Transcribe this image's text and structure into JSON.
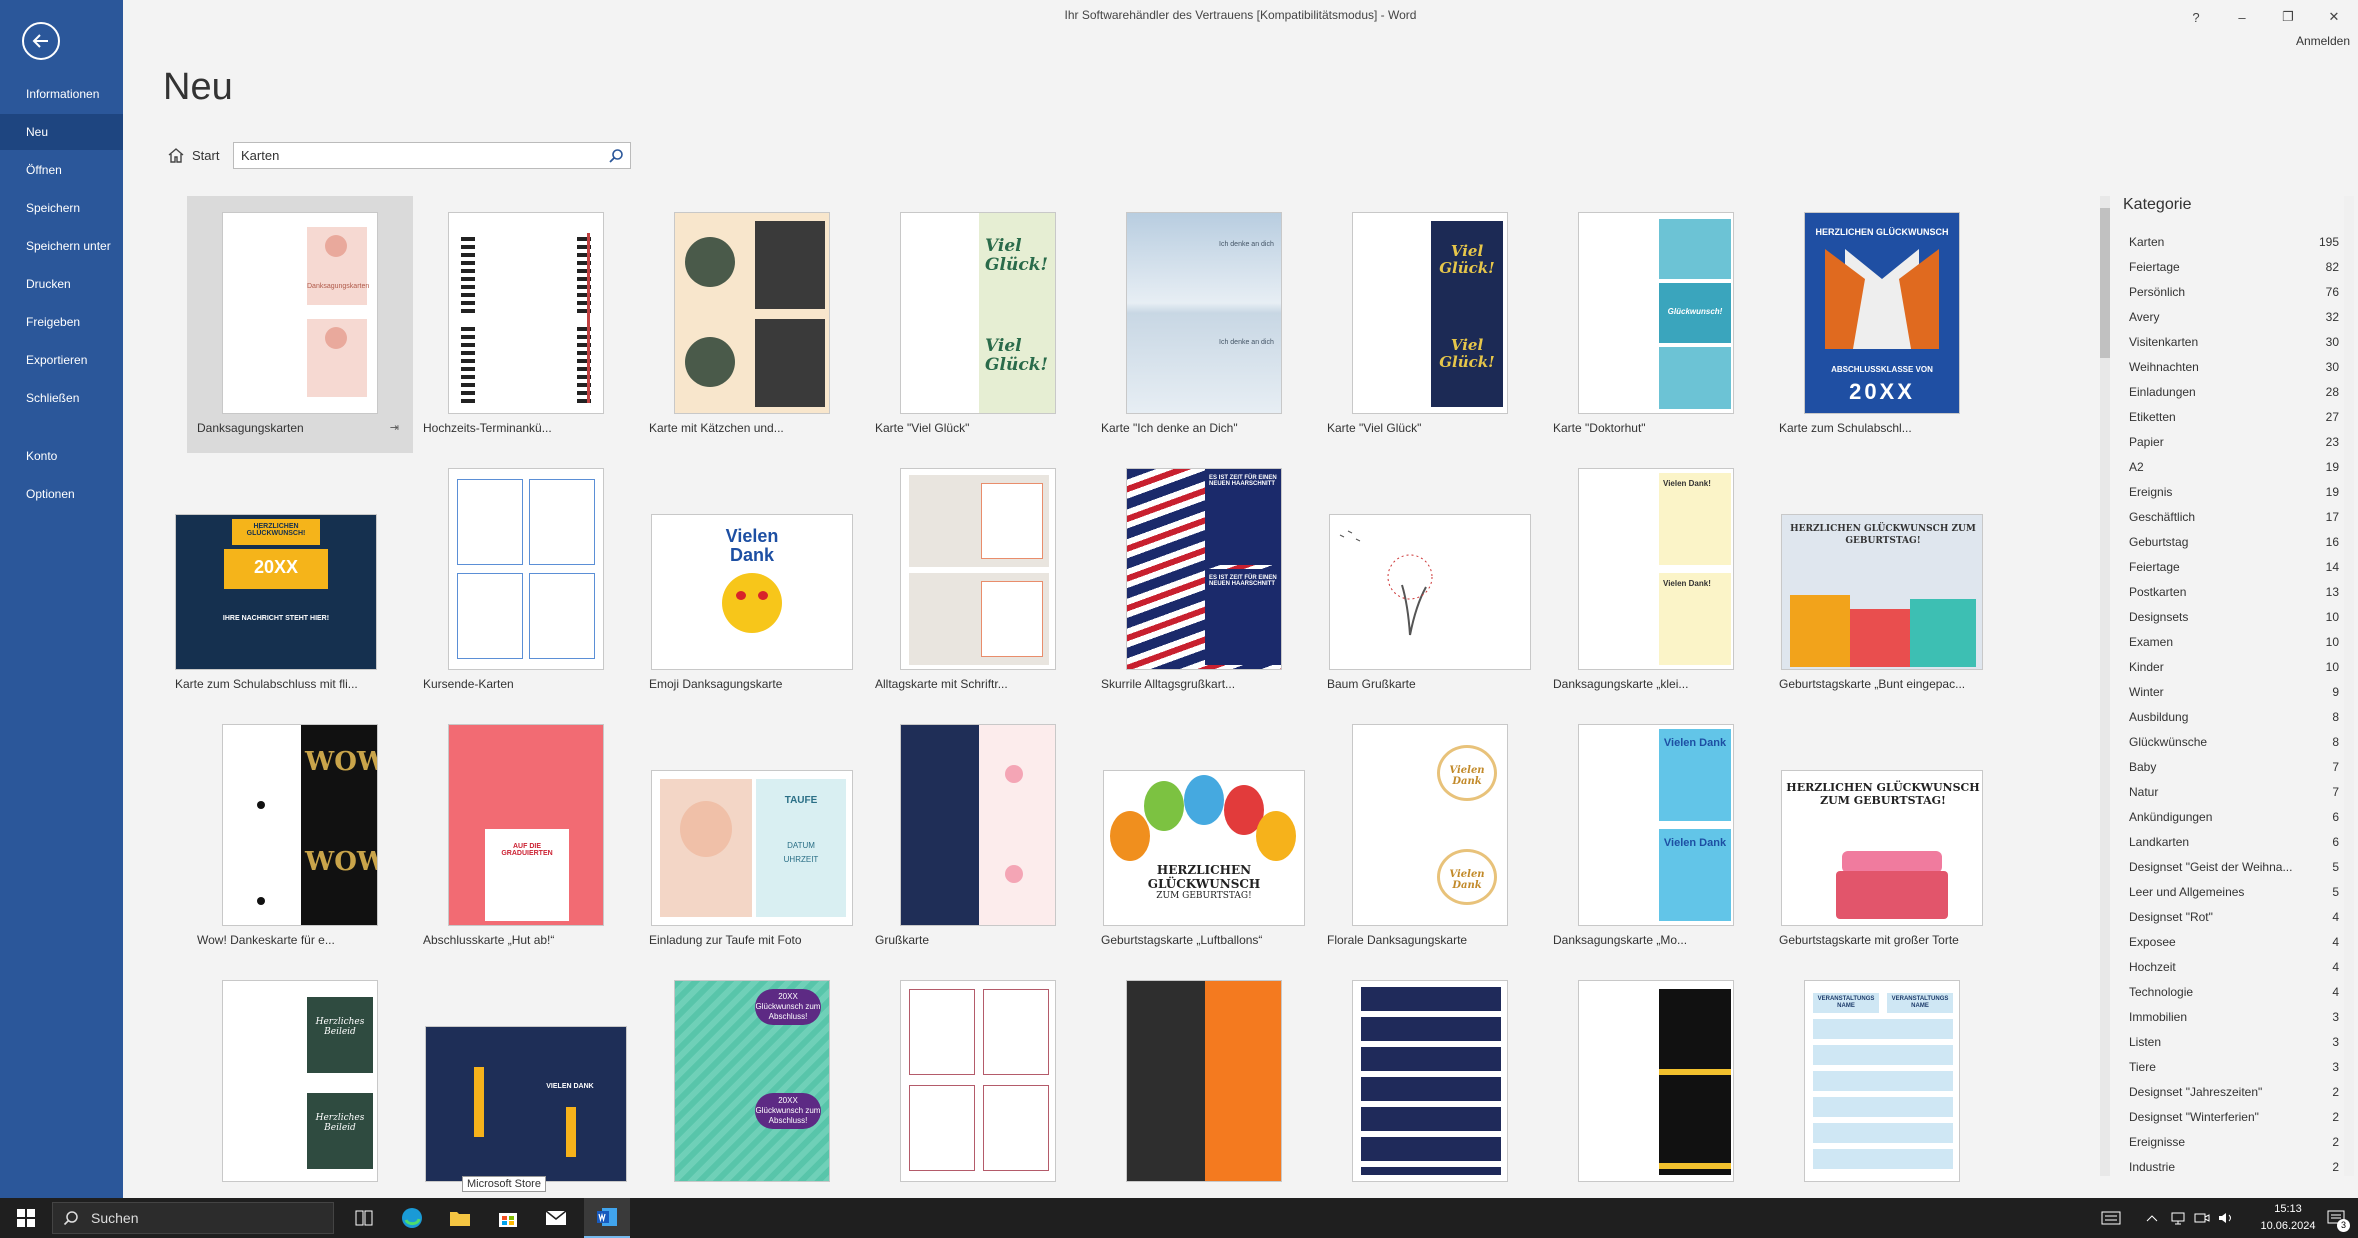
{
  "window": {
    "title": "Ihr Softwarehändler des Vertrauens [Kompatibilitätsmodus] - Word",
    "help": "?",
    "minimize": "–",
    "restore": "❐",
    "close": "✕",
    "signin": "Anmelden"
  },
  "sidebar": {
    "items": [
      {
        "label": "Informationen"
      },
      {
        "label": "Neu"
      },
      {
        "label": "Öffnen"
      },
      {
        "label": "Speichern"
      },
      {
        "label": "Speichern unter"
      },
      {
        "label": "Drucken"
      },
      {
        "label": "Freigeben"
      },
      {
        "label": "Exportieren"
      },
      {
        "label": "Schließen"
      },
      {
        "label": "Konto"
      },
      {
        "label": "Optionen"
      }
    ]
  },
  "main": {
    "title": "Neu",
    "start_label": "Start",
    "search_value": "Karten"
  },
  "templates": [
    {
      "name": "Danksagungskarten",
      "pin": "⇥"
    },
    {
      "name": "Hochzeits-Terminankü..."
    },
    {
      "name": "Karte mit Kätzchen und..."
    },
    {
      "name": "Karte \"Viel Glück\"",
      "text": "Viel Glück!"
    },
    {
      "name": "Karte \"Ich denke an Dich\"",
      "text": "Ich denke an dich"
    },
    {
      "name": "Karte \"Viel Glück\"",
      "text": "Viel Glück!"
    },
    {
      "name": "Karte \"Doktorhut\"",
      "text": "Glückwunsch!"
    },
    {
      "name": "Karte zum Schulabschl...",
      "text": "HERZLICHEN GLÜCKWUNSCH",
      "text2": "ABSCHLUSSKLASSE VON",
      "text3": "20XX"
    },
    {
      "name": "Karte zum Schulabschluss mit fli...",
      "text": "HERZLICHEN GLÜCKWUNSCH!",
      "text2": "20XX",
      "text3": "IHRE NACHRICHT STEHT HIER!"
    },
    {
      "name": "Kursende-Karten"
    },
    {
      "name": "Emoji Danksagungskarte",
      "text": "Vielen Dank"
    },
    {
      "name": "Alltagskarte mit Schriftr..."
    },
    {
      "name": "Skurrile Alltagsgrußkart...",
      "text": "ES IST ZEIT FÜR EINEN NEUEN HAARSCHNITT"
    },
    {
      "name": "Baum Grußkarte"
    },
    {
      "name": "Danksagungskarte „klei...",
      "text": "Vielen Dank!"
    },
    {
      "name": "Geburtstagskarte „Bunt eingepac...",
      "text": "HERZLICHEN GLÜCKWUNSCH ZUM GEBURTSTAG!"
    },
    {
      "name": "Wow! Dankeskarte für e...",
      "text": "WOW"
    },
    {
      "name": "Abschlusskarte „Hut ab!“",
      "text": "AUF DIE GRADUIERTEN"
    },
    {
      "name": "Einladung zur Taufe mit Foto",
      "text": "TAUFE",
      "text2": "DATUM",
      "text3": "UHRZEIT"
    },
    {
      "name": "Grußkarte"
    },
    {
      "name": "Geburtstagskarte „Luftballons“",
      "text": "HERZLICHEN GLÜCKWUNSCH",
      "text2": "ZUM GEBURTSTAG!"
    },
    {
      "name": "Florale Danksagungskarte",
      "text": "Vielen Dank"
    },
    {
      "name": "Danksagungskarte „Mo...",
      "text": "Vielen Dank"
    },
    {
      "name": "Geburtstagskarte mit großer Torte",
      "text": "HERZLICHEN GLÜCKWUNSCH ZUM GEBURTSTAG!"
    },
    {
      "name": "",
      "text": "Herzliches Beileid"
    },
    {
      "name": "",
      "text": "VIELEN DANK"
    },
    {
      "name": "",
      "text": "20XX Glückwunsch zum Abschluss!"
    },
    {
      "name": ""
    },
    {
      "name": ""
    },
    {
      "name": ""
    },
    {
      "name": ""
    },
    {
      "name": "",
      "text": "VERANSTALTUNGS NAME"
    }
  ],
  "tooltip": "Microsoft Store",
  "categories": {
    "title": "Kategorie",
    "items": [
      {
        "name": "Karten",
        "count": "195"
      },
      {
        "name": "Feiertage",
        "count": "82"
      },
      {
        "name": "Persönlich",
        "count": "76"
      },
      {
        "name": "Avery",
        "count": "32"
      },
      {
        "name": "Visitenkarten",
        "count": "30"
      },
      {
        "name": "Weihnachten",
        "count": "30"
      },
      {
        "name": "Einladungen",
        "count": "28"
      },
      {
        "name": "Etiketten",
        "count": "27"
      },
      {
        "name": "Papier",
        "count": "23"
      },
      {
        "name": "A2",
        "count": "19"
      },
      {
        "name": "Ereignis",
        "count": "19"
      },
      {
        "name": "Geschäftlich",
        "count": "17"
      },
      {
        "name": "Geburtstag",
        "count": "16"
      },
      {
        "name": "Feiertage",
        "count": "14"
      },
      {
        "name": "Postkarten",
        "count": "13"
      },
      {
        "name": "Designsets",
        "count": "10"
      },
      {
        "name": "Examen",
        "count": "10"
      },
      {
        "name": "Kinder",
        "count": "10"
      },
      {
        "name": "Winter",
        "count": "9"
      },
      {
        "name": "Ausbildung",
        "count": "8"
      },
      {
        "name": "Glückwünsche",
        "count": "8"
      },
      {
        "name": "Baby",
        "count": "7"
      },
      {
        "name": "Natur",
        "count": "7"
      },
      {
        "name": "Ankündigungen",
        "count": "6"
      },
      {
        "name": "Landkarten",
        "count": "6"
      },
      {
        "name": "Designset \"Geist der Weihna...",
        "count": "5"
      },
      {
        "name": "Leer und Allgemeines",
        "count": "5"
      },
      {
        "name": "Designset \"Rot\"",
        "count": "4"
      },
      {
        "name": "Exposee",
        "count": "4"
      },
      {
        "name": "Hochzeit",
        "count": "4"
      },
      {
        "name": "Technologie",
        "count": "4"
      },
      {
        "name": "Immobilien",
        "count": "3"
      },
      {
        "name": "Listen",
        "count": "3"
      },
      {
        "name": "Tiere",
        "count": "3"
      },
      {
        "name": "Designset \"Jahreszeiten\"",
        "count": "2"
      },
      {
        "name": "Designset \"Winterferien\"",
        "count": "2"
      },
      {
        "name": "Ereignisse",
        "count": "2"
      },
      {
        "name": "Industrie",
        "count": "2"
      }
    ]
  },
  "taskbar": {
    "search_placeholder": "Suchen",
    "time": "15:13",
    "date": "10.06.2024",
    "notifications": "3"
  }
}
